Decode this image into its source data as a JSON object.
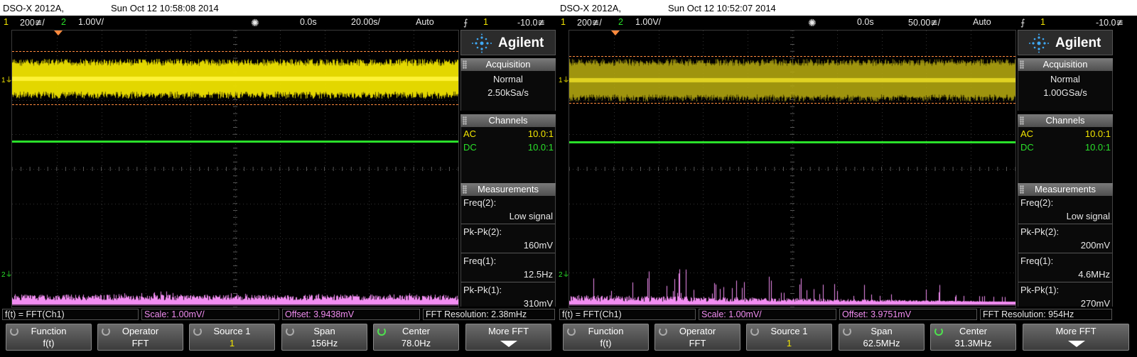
{
  "screens": [
    {
      "model": "DSO-X 2012A,",
      "datetime": "Sun Oct 12 10:58:08 2014",
      "status": {
        "ch1_num": "1",
        "ch1_scale": "200≇/",
        "ch2_num": "2",
        "ch2_scale": "1.00V/",
        "delay": "0.0s",
        "timebase": "20.00s/",
        "mode": "Auto",
        "trig_icon": "⨍",
        "trig_src": "1",
        "trig_level": "-10.0≇"
      },
      "logo": "Agilent",
      "acquisition": {
        "head": "Acquisition",
        "mode": "Normal",
        "rate": "2.50kSa/s"
      },
      "channels": {
        "head": "Channels",
        "ch1_coupling": "AC",
        "ch1_probe": "10.0:1",
        "ch2_coupling": "DC",
        "ch2_probe": "10.0:1"
      },
      "measurements": {
        "head": "Measurements",
        "items": [
          {
            "label": "Freq(2):",
            "value": "Low signal"
          },
          {
            "label": "Pk-Pk(2):",
            "value": "160mV"
          },
          {
            "label": "Freq(1):",
            "value": "12.5Hz"
          },
          {
            "label": "Pk-Pk(1):",
            "value": "310mV"
          }
        ]
      },
      "funcbar": {
        "func": "f(t) = FFT(Ch1)",
        "scale": "Scale: 1.00mV/",
        "offset": "Offset: 3.9438mV",
        "resolution": "FFT Resolution: 2.38mHz"
      },
      "softkeys": [
        {
          "l1": "Function",
          "l2": "f(t)"
        },
        {
          "l1": "Operator",
          "l2": "FFT"
        },
        {
          "l1": "Source 1",
          "l2": "1"
        },
        {
          "l1": "Span",
          "l2": "156Hz"
        },
        {
          "l1": "Center",
          "l2": "78.0Hz"
        },
        {
          "l1": "More FFT",
          "l2": ""
        }
      ],
      "ch_markers": {
        "ch1": "1",
        "ch2": "2"
      },
      "colors": {
        "ch1": "#f3e600",
        "ch2": "#2ae02a",
        "math": "#f28df2",
        "cursor": "#ff8a3d"
      }
    },
    {
      "model": "DSO-X 2012A,",
      "datetime": "Sun Oct 12 10:52:07 2014",
      "status": {
        "ch1_num": "1",
        "ch1_scale": "200≇/",
        "ch2_num": "2",
        "ch2_scale": "1.00V/",
        "delay": "0.0s",
        "timebase": "50.00≇/",
        "mode": "Auto",
        "trig_icon": "⨍",
        "trig_src": "1",
        "trig_level": "-10.0≇"
      },
      "logo": "Agilent",
      "acquisition": {
        "head": "Acquisition",
        "mode": "Normal",
        "rate": "1.00GSa/s"
      },
      "channels": {
        "head": "Channels",
        "ch1_coupling": "AC",
        "ch1_probe": "10.0:1",
        "ch2_coupling": "DC",
        "ch2_probe": "10.0:1"
      },
      "measurements": {
        "head": "Measurements",
        "items": [
          {
            "label": "Freq(2):",
            "value": "Low signal"
          },
          {
            "label": "Pk-Pk(2):",
            "value": "200mV"
          },
          {
            "label": "Freq(1):",
            "value": "4.6MHz"
          },
          {
            "label": "Pk-Pk(1):",
            "value": "270mV"
          }
        ]
      },
      "funcbar": {
        "func": "f(t) = FFT(Ch1)",
        "scale": "Scale: 1.00mV/",
        "offset": "Offset: 3.9751mV",
        "resolution": "FFT Resolution: 954Hz"
      },
      "softkeys": [
        {
          "l1": "Function",
          "l2": "f(t)"
        },
        {
          "l1": "Operator",
          "l2": "FFT"
        },
        {
          "l1": "Source 1",
          "l2": "1"
        },
        {
          "l1": "Span",
          "l2": "62.5MHz"
        },
        {
          "l1": "Center",
          "l2": "31.3MHz"
        },
        {
          "l1": "More FFT",
          "l2": ""
        }
      ],
      "ch_markers": {
        "ch1": "1",
        "ch2": "2"
      },
      "colors": {
        "ch1": "#f3e600",
        "ch2": "#2ae02a",
        "math": "#f28df2",
        "cursor": "#ff8a3d"
      }
    }
  ]
}
